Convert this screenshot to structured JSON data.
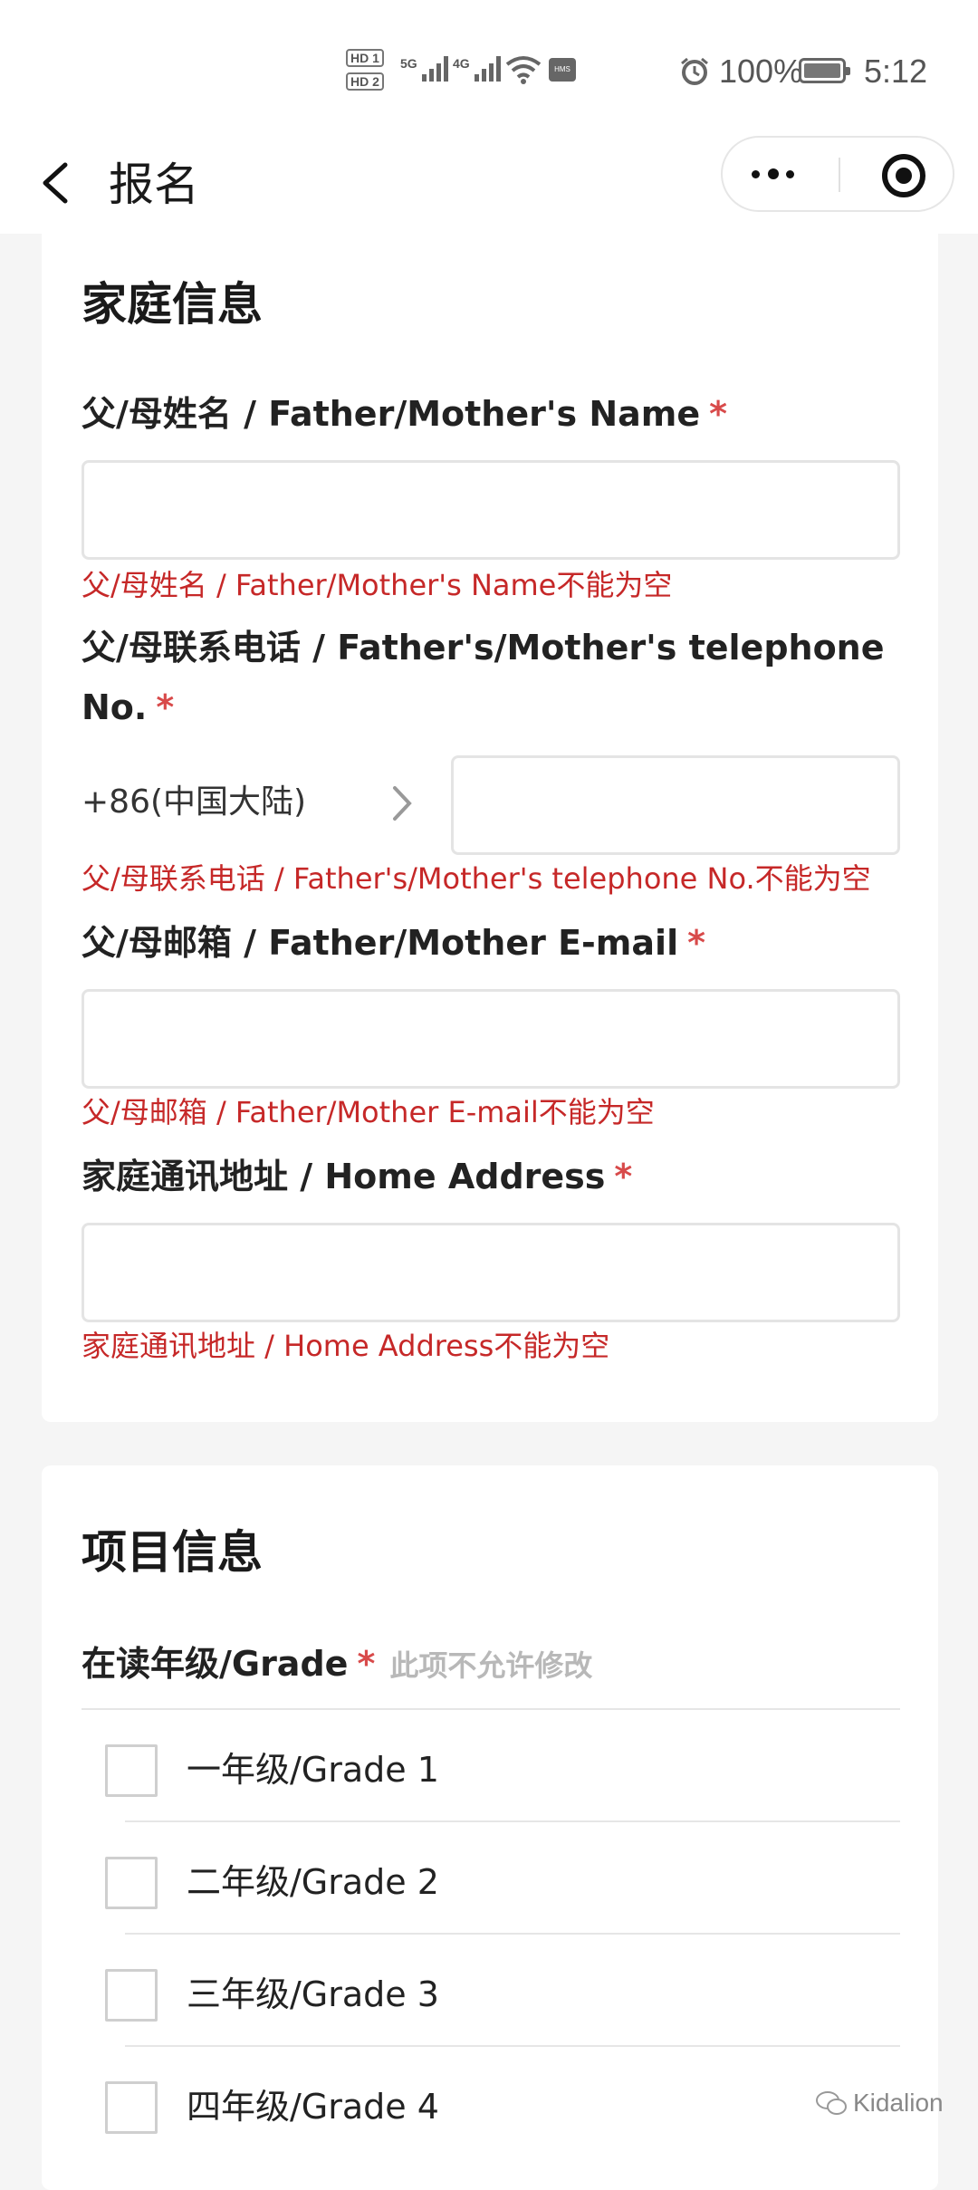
{
  "status_bar": {
    "hd1": "HD 1",
    "hd2": "HD 2",
    "net1": "5G",
    "net2": "4G",
    "hms": "HMS",
    "battery_pct": "100%",
    "time": "5:12"
  },
  "nav": {
    "title": "报名"
  },
  "family_section": {
    "title": "家庭信息",
    "parent_name": {
      "label": "父/母姓名 / Father/Mother's Name",
      "required_mark": "*",
      "value": "",
      "error": "父/母姓名 / Father/Mother's Name不能为空"
    },
    "parent_phone": {
      "label": "父/母联系电话 / Father's/Mother's telephone No.",
      "required_mark": "*",
      "country_code": "+86(中国大陆)",
      "value": "",
      "error": "父/母联系电话 / Father's/Mother's telephone No.不能为空"
    },
    "parent_email": {
      "label": "父/母邮箱 / Father/Mother E-mail",
      "required_mark": "*",
      "value": "",
      "error": "父/母邮箱 / Father/Mother E-mail不能为空"
    },
    "home_address": {
      "label": "家庭通讯地址 / Home Address",
      "required_mark": "*",
      "value": "",
      "error": "家庭通讯地址 / Home Address不能为空"
    }
  },
  "project_section": {
    "title": "项目信息",
    "grade": {
      "label": "在读年级/Grade",
      "required_mark": "*",
      "readonly_note": "此项不允许修改",
      "options": [
        {
          "label": "一年级/Grade 1",
          "checked": false
        },
        {
          "label": "二年级/Grade 2",
          "checked": false
        },
        {
          "label": "三年级/Grade 3",
          "checked": false
        },
        {
          "label": "四年级/Grade 4",
          "checked": false
        }
      ]
    }
  },
  "watermark": {
    "text": "Kidalion"
  },
  "colors": {
    "required": "#d84a4a",
    "error": "#c62828",
    "title_underline": "#f2c2c2",
    "page_bg": "#f5f5f5"
  }
}
